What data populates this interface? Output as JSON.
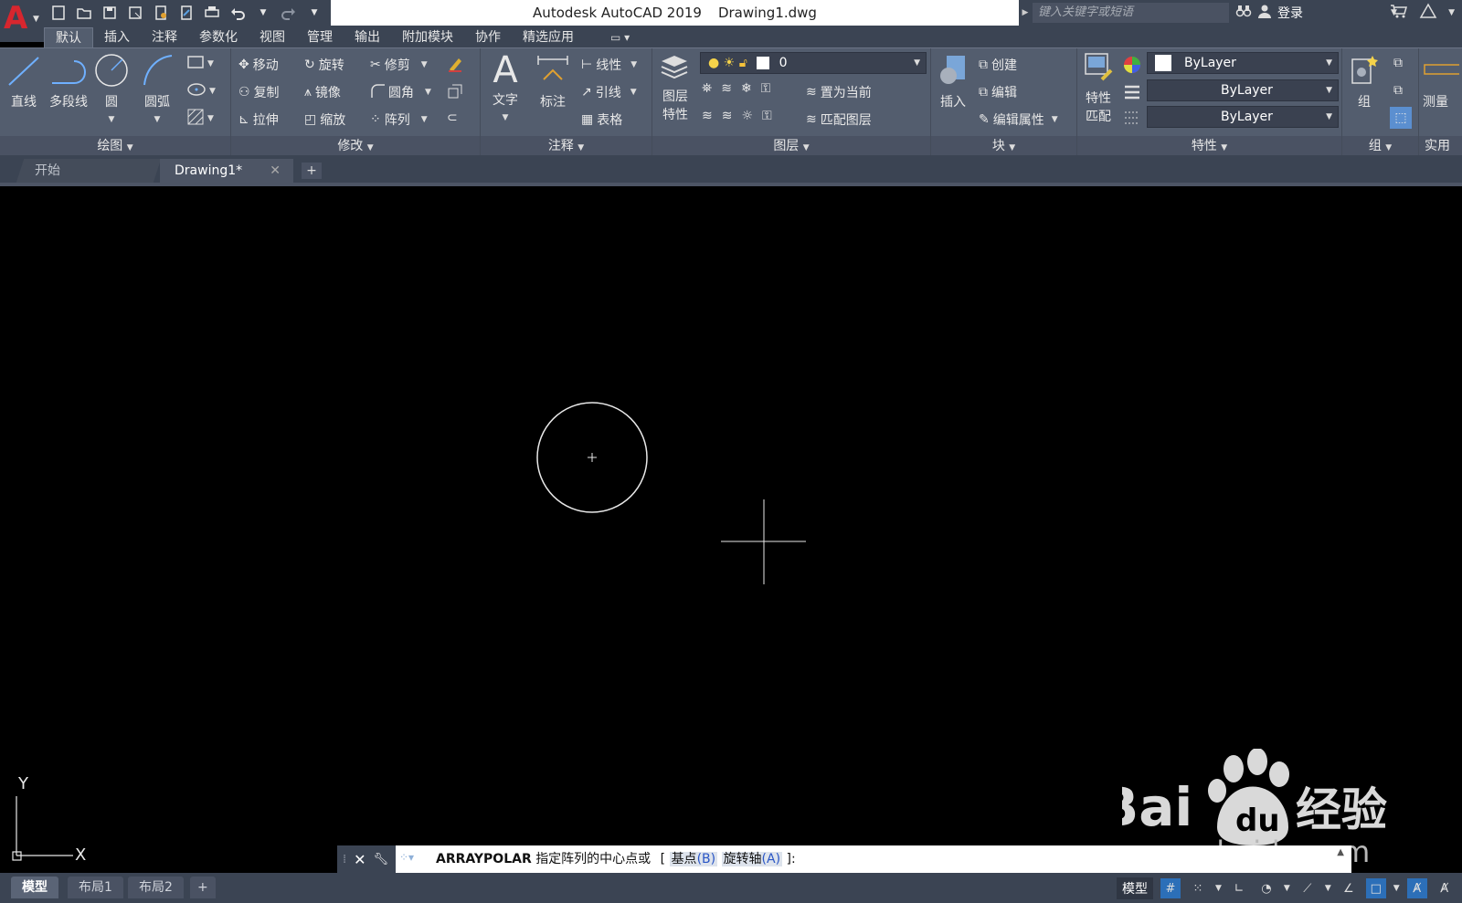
{
  "app": {
    "title": "Autodesk AutoCAD 2019",
    "document": "Drawing1.dwg",
    "search_placeholder": "键入关键字或短语",
    "signin_label": "登录"
  },
  "ribbon_tabs": [
    "默认",
    "插入",
    "注释",
    "参数化",
    "视图",
    "管理",
    "输出",
    "附加模块",
    "协作",
    "精选应用"
  ],
  "ribbon": {
    "draw": {
      "title": "绘图",
      "line": "直线",
      "polyline": "多段线",
      "circle": "圆",
      "arc": "圆弧"
    },
    "modify": {
      "title": "修改",
      "move": "移动",
      "rotate": "旋转",
      "trim": "修剪",
      "copy": "复制",
      "mirror": "镜像",
      "fillet": "圆角",
      "stretch": "拉伸",
      "scale": "缩放",
      "array": "阵列"
    },
    "annotation": {
      "title": "注释",
      "text": "文字",
      "dimension": "标注",
      "linear": "线性",
      "leader": "引线",
      "table": "表格"
    },
    "layers": {
      "title": "图层",
      "layer_properties_line1": "图层",
      "layer_properties_line2": "特性",
      "current_layer": "0",
      "make_current": "置为当前",
      "match_layer": "匹配图层"
    },
    "block": {
      "title": "块",
      "insert": "插入",
      "create": "创建",
      "edit": "编辑",
      "edit_attributes": "编辑属性"
    },
    "properties": {
      "title": "特性",
      "match_line1": "特性",
      "match_line2": "匹配",
      "color": "ByLayer",
      "lineweight": "ByLayer",
      "linetype": "ByLayer"
    },
    "groups": {
      "title": "组",
      "group": "组"
    },
    "utilities": {
      "title": "实用工",
      "measure": "测量"
    }
  },
  "file_tabs": {
    "start": "开始",
    "active": "Drawing1*"
  },
  "ucs": {
    "x_label": "X",
    "y_label": "Y"
  },
  "command_line": {
    "command": "ARRAYPOLAR",
    "prompt": "指定阵列的中心点或",
    "bracket_open": "[",
    "option1_label": "基点",
    "option1_key": "(B)",
    "option2_label": "旋转轴",
    "option2_key": "(A)",
    "bracket_close": "]:"
  },
  "watermark": {
    "brand": "Bai",
    "brand2": "du",
    "cn": "经验",
    "url": "jingyan.baidu.com"
  },
  "layout_tabs": [
    "模型",
    "布局1",
    "布局2"
  ],
  "status": {
    "model_label": "模型"
  },
  "colors": {
    "chrome": "#3b4453",
    "ribbon": "#535d6e",
    "canvas": "#000000",
    "logo_red": "#d7262e",
    "toggle_on": "#2c6fb8"
  }
}
